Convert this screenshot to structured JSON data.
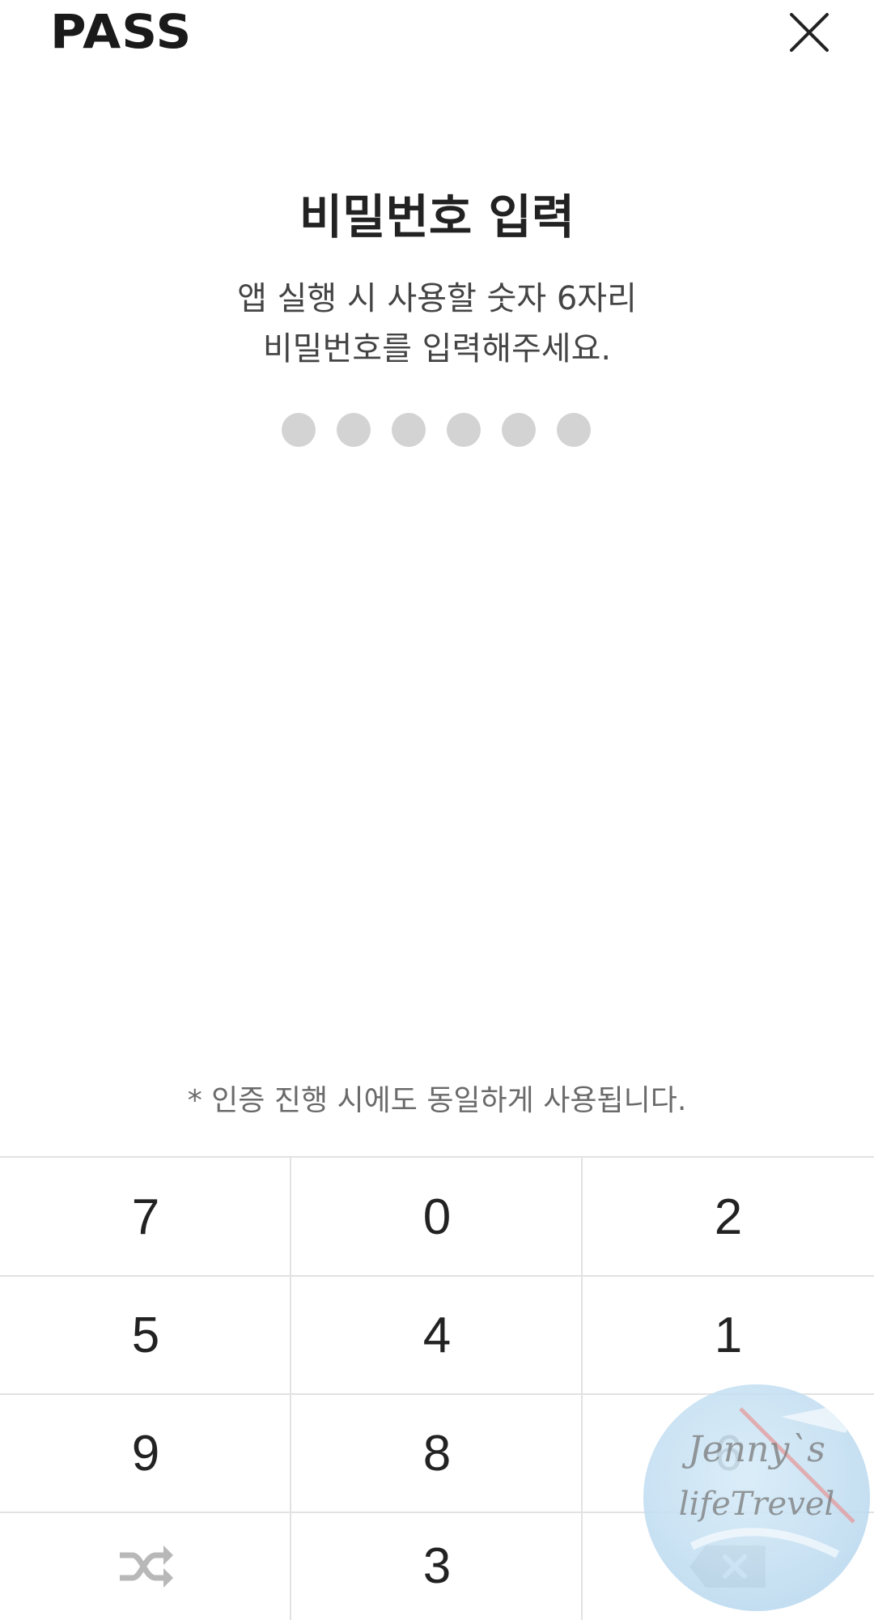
{
  "header": {
    "logo": "PASS",
    "close_icon": "close-icon"
  },
  "main": {
    "title": "비밀번호 입력",
    "subtitle_line1": "앱 실행 시 사용할 숫자 6자리",
    "subtitle_line2": "비밀번호를 입력해주세요.",
    "pin_length": 6,
    "pin_entered": 0
  },
  "notice": "* 인증 진행 시에도 동일하게 사용됩니다.",
  "keypad": {
    "rows": [
      [
        "7",
        "0",
        "2"
      ],
      [
        "5",
        "4",
        "1"
      ],
      [
        "9",
        "8",
        "6"
      ],
      [
        "shuffle-icon",
        "3",
        "backspace-icon"
      ]
    ],
    "row1": {
      "k1": "7",
      "k2": "0",
      "k3": "2"
    },
    "row2": {
      "k1": "5",
      "k2": "4",
      "k3": "1"
    },
    "row3": {
      "k1": "9",
      "k2": "8",
      "k3": "6"
    },
    "row4": {
      "k2": "3"
    }
  },
  "watermark": {
    "line1": "Jenny`s",
    "line2": "lifeTrevel"
  },
  "colors": {
    "dot_empty": "#d3d3d3",
    "divider": "#e2e2e2",
    "text_primary": "#222222",
    "text_secondary": "#444444"
  }
}
